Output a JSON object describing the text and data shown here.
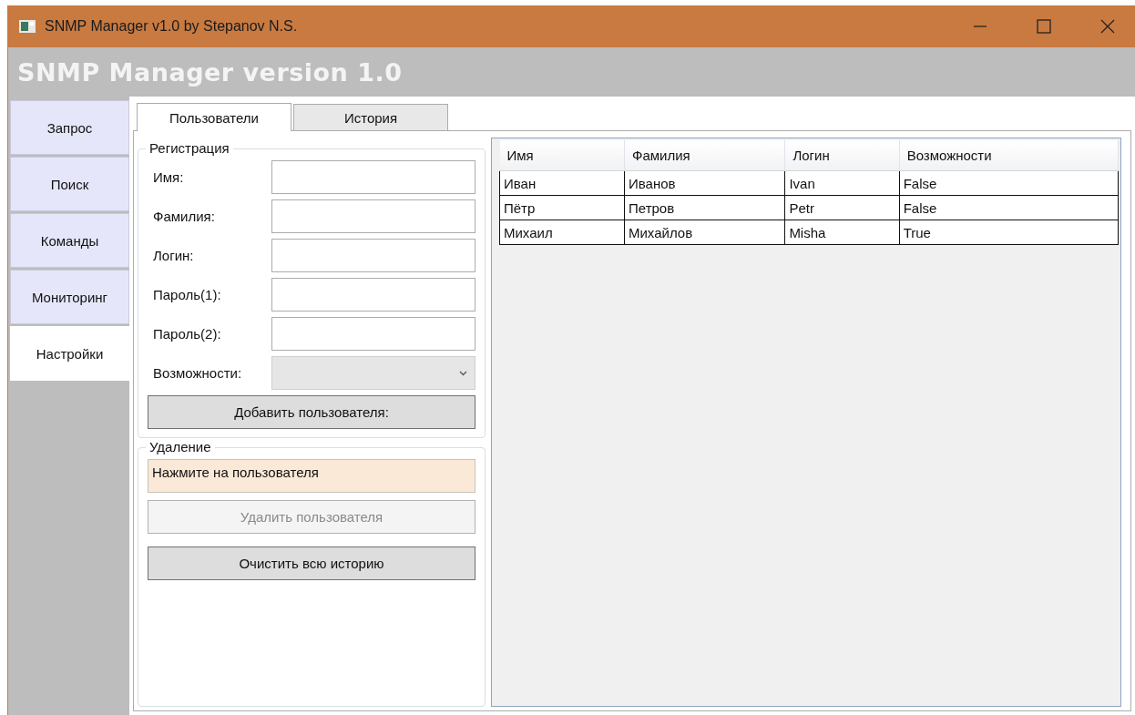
{
  "window": {
    "title": "SNMP Manager v1.0 by Stepanov N.S."
  },
  "header": {
    "title": "SNMP Manager version 1.0"
  },
  "sidebar": {
    "items": [
      {
        "label": "Запрос",
        "selected": false
      },
      {
        "label": "Поиск",
        "selected": false
      },
      {
        "label": "Команды",
        "selected": false
      },
      {
        "label": "Мониторинг",
        "selected": false
      },
      {
        "label": "Настройки",
        "selected": true
      }
    ]
  },
  "tabs": [
    {
      "label": "Пользователи",
      "selected": true
    },
    {
      "label": "История",
      "selected": false
    }
  ],
  "registration": {
    "legend": "Регистрация",
    "fields": [
      {
        "label": "Имя:",
        "kind": "text"
      },
      {
        "label": "Фамилия:",
        "kind": "text"
      },
      {
        "label": "Логин:",
        "kind": "text"
      },
      {
        "label": "Пароль(1):",
        "kind": "text"
      },
      {
        "label": "Пароль(2):",
        "kind": "text"
      },
      {
        "label": "Возможности:",
        "kind": "select"
      }
    ],
    "button": "Добавить пользователя:"
  },
  "deletion": {
    "legend": "Удаление",
    "hint": "Нажмите на пользователя",
    "delete_button": {
      "label": "Удалить пользователя",
      "disabled": true
    },
    "clear_button": {
      "label": "Очистить всю историю",
      "disabled": false
    }
  },
  "table": {
    "columns": [
      "Имя",
      "Фамилия",
      "Логин",
      "Возможности"
    ],
    "rows": [
      [
        "Иван",
        "Иванов",
        "Ivan",
        "False"
      ],
      [
        "Пётр",
        "Петров",
        "Petr",
        "False"
      ],
      [
        "Михаил",
        "Михайлов",
        "Misha",
        "True"
      ]
    ]
  }
}
